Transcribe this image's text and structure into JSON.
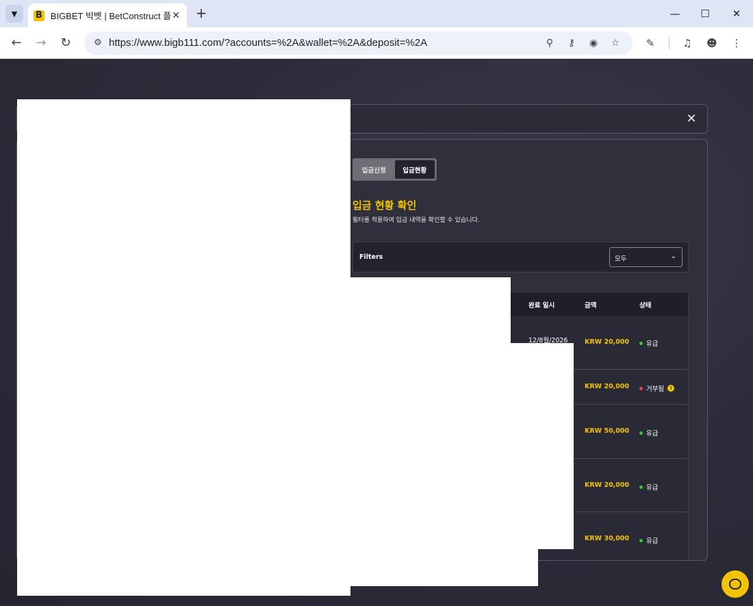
{
  "browser": {
    "tab_title": "BIGBET 빅벳 | BetConstruct 플",
    "favicon_letter": "B",
    "url": "https://www.bigb111.com/?accounts=%2A&wallet=%2A&deposit=%2A",
    "icons": [
      "tab-list-icon",
      "close-tab-icon",
      "new-tab-icon",
      "minimize-icon",
      "maximize-icon",
      "close-window-icon",
      "back-icon",
      "forward-icon",
      "reload-icon",
      "site-info-icon",
      "zoom-icon",
      "password-key-icon",
      "eye-off-icon",
      "star-icon",
      "extensions-icon",
      "media-icon",
      "profile-icon",
      "menu-icon"
    ]
  },
  "subtabs": [
    {
      "label": "입금신청",
      "active": false
    },
    {
      "label": "입금현황",
      "active": true
    }
  ],
  "section": {
    "title": "입금 현황 확인",
    "description": "필터를 적용하여 입금 내역을 확인할 수 있습니다."
  },
  "filters": {
    "label": "Filters",
    "selected": "모두"
  },
  "table": {
    "headers": {
      "date": "완료 일시",
      "amount": "금액",
      "status": "상태"
    },
    "rows": [
      {
        "date": "12/8월/2026",
        "amount": "KRW 20,000",
        "status": "유급",
        "status_color": "#3cc43c",
        "info": false
      },
      {
        "date": "",
        "amount": "KRW 20,000",
        "status": "거부됨",
        "status_color": "#e84848",
        "info": true
      },
      {
        "date": "",
        "amount": "KRW 50,000",
        "status": "유급",
        "status_color": "#3cc43c",
        "info": false
      },
      {
        "date": "",
        "amount": "KRW 20,000",
        "status": "유급",
        "status_color": "#3cc43c",
        "info": false
      },
      {
        "date": "",
        "amount": "KRW 30,000",
        "status": "유급",
        "status_color": "#3cc43c",
        "info": false
      }
    ]
  },
  "colors": {
    "accent": "#f2c300",
    "paid": "#3cc43c",
    "rejected": "#e84848"
  }
}
